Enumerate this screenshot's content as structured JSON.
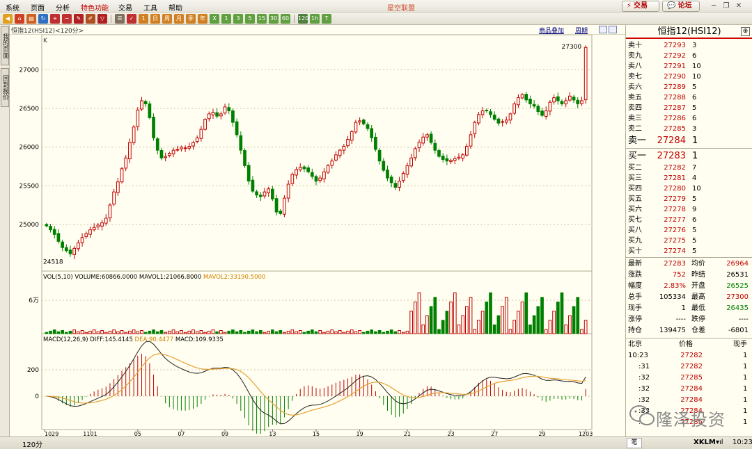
{
  "menu": {
    "items": [
      "系统",
      "页面",
      "分析",
      "特色功能",
      "交易",
      "工具",
      "帮助"
    ],
    "app_title": "星空联盟",
    "trade_button": "交易",
    "forum_button": "论坛"
  },
  "sidebar": {
    "tabs": [
      "我的页面",
      "回到报价"
    ]
  },
  "chart_header": {
    "title": "恒指12(HSI12)<120分>",
    "overlay_link": "商品叠加",
    "period_link": "周期"
  },
  "quote": {
    "title": "恒指12(HSI12)",
    "asks": [
      {
        "label": "卖十",
        "price": "27293",
        "qty": "3"
      },
      {
        "label": "卖九",
        "price": "27292",
        "qty": "6"
      },
      {
        "label": "卖八",
        "price": "27291",
        "qty": "10"
      },
      {
        "label": "卖七",
        "price": "27290",
        "qty": "10"
      },
      {
        "label": "卖六",
        "price": "27289",
        "qty": "5"
      },
      {
        "label": "卖五",
        "price": "27288",
        "qty": "6"
      },
      {
        "label": "卖四",
        "price": "27287",
        "qty": "5"
      },
      {
        "label": "卖三",
        "price": "27286",
        "qty": "6"
      },
      {
        "label": "卖二",
        "price": "27285",
        "qty": "3"
      },
      {
        "label": "卖一",
        "price": "27284",
        "qty": "1"
      }
    ],
    "bids": [
      {
        "label": "买一",
        "price": "27283",
        "qty": "1"
      },
      {
        "label": "买二",
        "price": "27282",
        "qty": "7"
      },
      {
        "label": "买三",
        "price": "27281",
        "qty": "4"
      },
      {
        "label": "买四",
        "price": "27280",
        "qty": "10"
      },
      {
        "label": "买五",
        "price": "27279",
        "qty": "5"
      },
      {
        "label": "买六",
        "price": "27278",
        "qty": "9"
      },
      {
        "label": "买七",
        "price": "27277",
        "qty": "6"
      },
      {
        "label": "买八",
        "price": "27276",
        "qty": "5"
      },
      {
        "label": "买九",
        "price": "27275",
        "qty": "5"
      },
      {
        "label": "买十",
        "price": "27274",
        "qty": "5"
      }
    ],
    "stats": [
      {
        "l1": "最新",
        "v1": "27283",
        "c1": "red",
        "l2": "均价",
        "v2": "26964",
        "c2": "red"
      },
      {
        "l1": "涨跌",
        "v1": "752",
        "c1": "red",
        "l2": "昨结",
        "v2": "26531",
        "c2": "blk"
      },
      {
        "l1": "幅度",
        "v1": "2.83%",
        "c1": "red",
        "l2": "开盘",
        "v2": "26525",
        "c2": "grn"
      },
      {
        "l1": "总手",
        "v1": "105334",
        "c1": "blk",
        "l2": "最高",
        "v2": "27300",
        "c2": "red"
      },
      {
        "l1": "现手",
        "v1": "1",
        "c1": "blk",
        "l2": "最低",
        "v2": "26435",
        "c2": "grn"
      },
      {
        "l1": "涨停",
        "v1": "----",
        "c1": "blk",
        "l2": "跌停",
        "v2": "----",
        "c2": "blk"
      },
      {
        "l1": "持仓",
        "v1": "139475",
        "c1": "blk",
        "l2": "仓差",
        "v2": "-6801",
        "c2": "blk"
      }
    ],
    "ticks_header": {
      "time": "北京",
      "price": "价格",
      "qty": "现手"
    },
    "ticks": [
      {
        "time": "10:23",
        "price": "27282",
        "qty": "1"
      },
      {
        "time": ":31",
        "price": "27282",
        "qty": "1"
      },
      {
        "time": ":32",
        "price": "27285",
        "qty": "1"
      },
      {
        "time": ":32",
        "price": "27284",
        "qty": "1"
      },
      {
        "time": ":32",
        "price": "27284",
        "qty": "1"
      },
      {
        "time": ":33",
        "price": "27284",
        "qty": "1"
      },
      {
        "time": ":33",
        "price": "27285",
        "qty": "1"
      }
    ],
    "bottom_tab": "笔"
  },
  "status": {
    "left": "120分",
    "right_time": "10:23",
    "brand": "XKLM"
  },
  "watermark": "隆泽投资",
  "colors": {
    "up": "#c00000",
    "down": "#008000",
    "background": "#fffef0",
    "grid": "#c8c4a8",
    "dif_line": "#202020",
    "dea_line": "#e8a030"
  },
  "chart_data": [
    {
      "type": "candlestick",
      "title": "K",
      "yticks": [
        25000,
        25500,
        26000,
        26500,
        27000
      ],
      "ylim": [
        24450,
        27400
      ],
      "xticks": [
        "1029",
        "1101",
        "05",
        "07",
        "09",
        "13",
        "15",
        "19",
        "21",
        "23",
        "27",
        "29",
        "1203"
      ],
      "annotations": {
        "high": "27300",
        "low": "24518"
      },
      "series_close": [
        24980,
        24930,
        24870,
        24780,
        24700,
        24660,
        24620,
        24690,
        24760,
        24830,
        24880,
        24930,
        24960,
        24990,
        25020,
        25080,
        25250,
        25420,
        25550,
        25720,
        25860,
        26060,
        26260,
        26480,
        26600,
        26560,
        26380,
        26120,
        25960,
        25860,
        25880,
        25920,
        25960,
        25970,
        26000,
        25990,
        26010,
        26060,
        26120,
        26230,
        26360,
        26430,
        26450,
        26400,
        26430,
        26520,
        26470,
        26320,
        26160,
        25960,
        25760,
        25560,
        25430,
        25380,
        25360,
        25420,
        25460,
        25330,
        25160,
        25140,
        25340,
        25520,
        25650,
        25710,
        25740,
        25720,
        25680,
        25620,
        25560,
        25600,
        25680,
        25760,
        25820,
        25900,
        25960,
        26010,
        26100,
        26200,
        26320,
        26340,
        26300,
        26240,
        26120,
        25970,
        25820,
        25700,
        25600,
        25540,
        25480,
        25560,
        25660,
        25760,
        25860,
        25980,
        26060,
        26130,
        26160,
        26060,
        25960,
        25880,
        25840,
        25820,
        25830,
        25850,
        25870,
        25900,
        26010,
        26160,
        26320,
        26420,
        26470,
        26470,
        26420,
        26360,
        26310,
        26330,
        26350,
        26430,
        26560,
        26640,
        26680,
        26610,
        26560,
        26530,
        26460,
        26410,
        26470,
        26580,
        26640,
        26600,
        26560,
        26600,
        26660,
        26610,
        26560,
        26600,
        27290
      ],
      "volume": {
        "label": "VOL(5,10)",
        "volume_text": "VOLUME:60866.0000",
        "mavol1_text": "MAVOL1:21066.8000",
        "mavol2_text": "MAVOL2:33190.5000",
        "ytick": "6万"
      },
      "macd": {
        "label": "MACD(12,26,9)",
        "dif_text": "DIFF:145.4145",
        "dea_text": "DEA:90.4477",
        "macd_text": "MACD:109.9335",
        "yticks": [
          "200",
          "0"
        ]
      }
    }
  ]
}
